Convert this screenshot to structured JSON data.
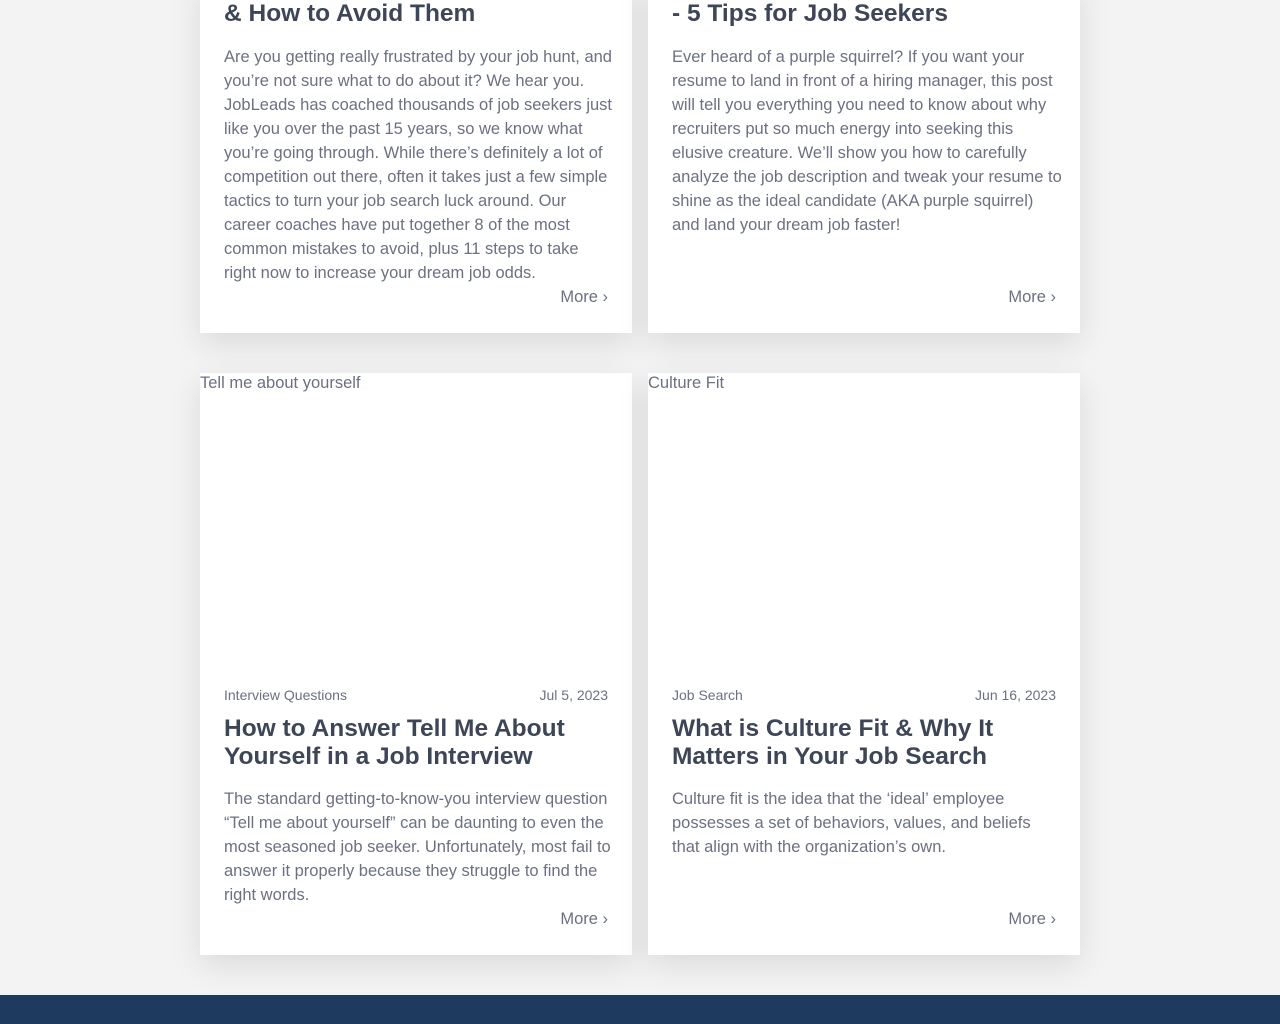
{
  "top_cards": [
    {
      "title_tail": "& How to Avoid Them",
      "excerpt": "Are you getting really frustrated by your job hunt, and you’re not sure what to do about it? We hear you. JobLeads has coached thousands of job seekers just like you over the past 15 years, so we know what you’re going through. While there’s definitely a lot of competition out there, often it takes just a few simple tactics to turn your job search luck around. Our career coaches have put together 8 of the most common mistakes to avoid, plus 11 steps to take right now to increase your dream job odds.",
      "more": "More ›"
    },
    {
      "title_tail": "- 5 Tips for Job Seekers",
      "excerpt": "Ever heard of a purple squirrel? If you want your resume to land in front of a hiring manager, this post will tell you everything you need to know about why recruiters put so much energy into seeking this elusive creature. We’ll show you how to carefully analyze the job description and tweak your resume to shine as the ideal candidate (AKA purple squirrel) and land your dream job faster!",
      "more": "More ›"
    }
  ],
  "bottom_cards": [
    {
      "image_alt": "Tell me about yourself",
      "category": "Interview Questions",
      "date": "Jul 5, 2023",
      "title": "How to Answer Tell Me About Yourself in a Job Interview",
      "excerpt": "The standard getting-to-know-you interview question “Tell me about yourself” can be daunting to even the most seasoned job seeker. Unfortunately, most fail to answer it properly because they struggle to find the right words.",
      "more": "More ›"
    },
    {
      "image_alt": "Culture Fit",
      "category": "Job Search",
      "date": "Jun 16, 2023",
      "title": "What is Culture Fit & Why It Matters in Your Job Search",
      "excerpt": "Culture fit is the idea that the ‘ideal’ employee possesses a set of behaviors, values, and beliefs that align with the organization’s own.",
      "more": "More ›"
    }
  ],
  "colors": {
    "background": "#f3f3f3",
    "card": "#ffffff",
    "title": "#3d4656",
    "text": "#6b7180",
    "footer": "#1e3a5f"
  }
}
